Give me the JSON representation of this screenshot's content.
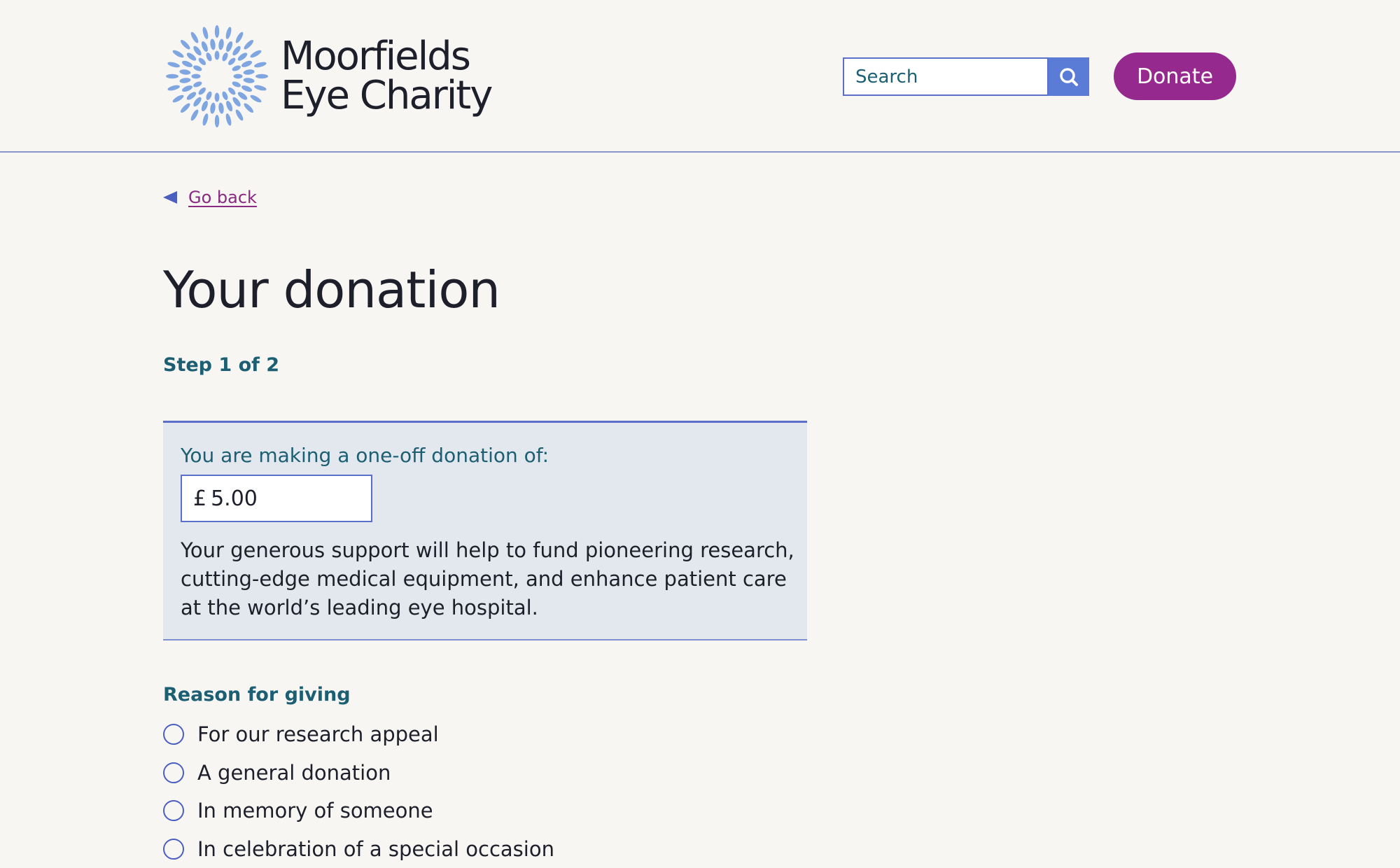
{
  "header": {
    "logo": {
      "line1": "Moorfields",
      "line2": "Eye Charity",
      "icon": "sunburst-eye-logo",
      "color": "#7fa6e0"
    },
    "search": {
      "placeholder": "Search",
      "button_icon": "search-icon"
    },
    "donate_label": "Donate"
  },
  "nav": {
    "back_label": "Go back",
    "back_icon": "left-triangle-icon"
  },
  "page": {
    "title": "Your donation",
    "step": "Step 1 of 2"
  },
  "donation_panel": {
    "label": "You are making a one-off donation of:",
    "currency": "£",
    "amount": "5.00",
    "description": "Your generous support will help to fund pioneering research, cutting-edge medical equipment, and enhance patient care at the world’s leading eye hospital."
  },
  "reason": {
    "heading": "Reason for giving",
    "options": [
      {
        "label": "For our research appeal"
      },
      {
        "label": "A general donation"
      },
      {
        "label": "In memory of someone"
      },
      {
        "label": "In celebration of a special occasion"
      }
    ]
  },
  "colors": {
    "background": "#f7f6f3",
    "accent_blue": "#5a7bd6",
    "donate_purple": "#95298e",
    "teal_heading": "#1c5f73",
    "panel_bg": "#e3e7ee"
  }
}
